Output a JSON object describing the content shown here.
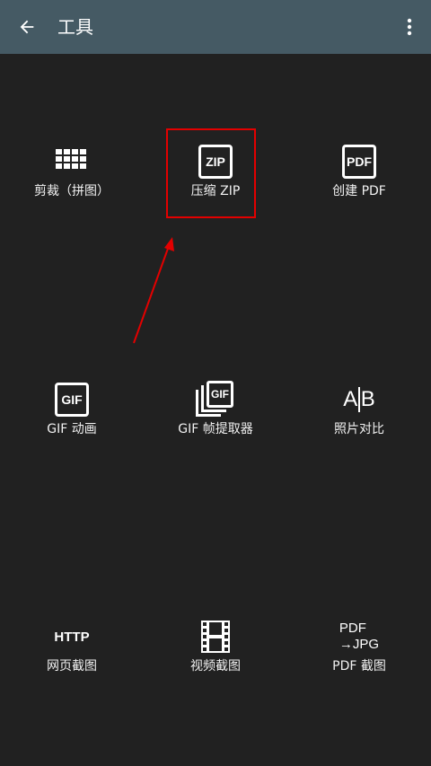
{
  "appbar": {
    "title": "工具",
    "back_icon": "arrow-left-icon",
    "more_icon": "more-vertical-icon",
    "background": "#455a64"
  },
  "tools": {
    "crop_collage": {
      "label": "剪裁（拼图）",
      "icon": "grid-icon"
    },
    "zip": {
      "label": "压缩 ZIP",
      "icon": "zip-icon",
      "icon_text": "ZIP"
    },
    "create_pdf": {
      "label": "创建 PDF",
      "icon": "pdf-icon",
      "icon_text": "PDF"
    },
    "gif_animation": {
      "label": "GIF 动画",
      "icon": "gif-icon",
      "icon_text": "GIF"
    },
    "gif_frame_extractor": {
      "label": "GIF 帧提取器",
      "icon": "gif-frames-icon",
      "icon_text": "GIF"
    },
    "photo_compare": {
      "label": "照片对比",
      "icon": "ab-compare-icon",
      "icon_text_a": "A",
      "icon_text_b": "B"
    },
    "web_screenshot": {
      "label": "网页截图",
      "icon": "http-icon",
      "icon_text": "HTTP"
    },
    "video_screenshot": {
      "label": "视频截图",
      "icon": "film-icon"
    },
    "pdf_screenshot": {
      "label": "PDF 截图",
      "icon": "pdf-to-jpg-icon",
      "icon_text_line1": "PDF",
      "icon_text_line2": "→JPG"
    }
  },
  "annotation": {
    "highlight_color": "#e30000"
  }
}
